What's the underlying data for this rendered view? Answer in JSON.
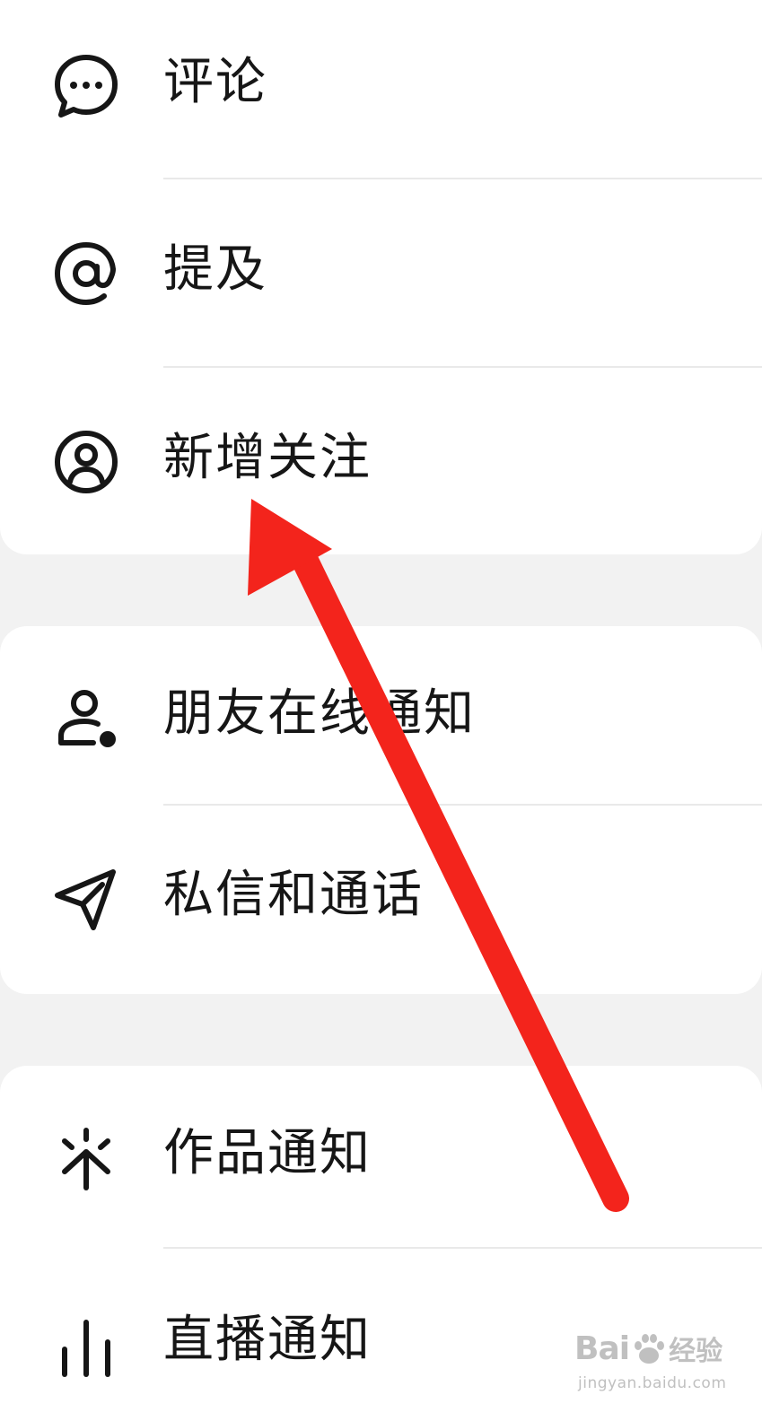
{
  "groups": [
    {
      "items": [
        {
          "label": "评论",
          "icon": "comment-bubble-icon"
        },
        {
          "label": "提及",
          "icon": "at-sign-icon"
        },
        {
          "label": "新增关注",
          "icon": "user-circle-icon"
        }
      ]
    },
    {
      "items": [
        {
          "label": "朋友在线通知",
          "icon": "user-online-icon"
        },
        {
          "label": "私信和通话",
          "icon": "paper-plane-icon"
        }
      ]
    },
    {
      "items": [
        {
          "label": "作品通知",
          "icon": "sparkle-arrow-icon"
        },
        {
          "label": "直播通知",
          "icon": "bar-chart-icon"
        }
      ]
    }
  ],
  "annotation": {
    "arrow_color": "#f3241c",
    "points_to": "新增关注"
  },
  "watermark": {
    "brand": "Bai",
    "brand_suffix": "经验",
    "url": "jingyan.baidu.com"
  }
}
